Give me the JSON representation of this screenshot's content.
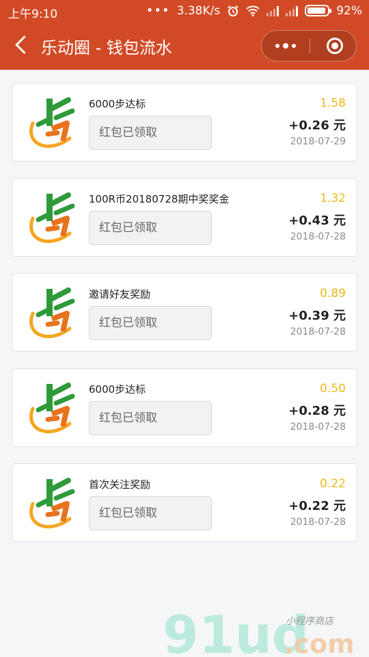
{
  "status_bar": {
    "time": "上午9:10",
    "network_speed": "3.38K/s",
    "battery": "92%"
  },
  "nav": {
    "title": "乐动圈 - 钱包流水"
  },
  "records": [
    {
      "title": "6000步达标",
      "status": "红包已领取",
      "total": "1.58",
      "amount": "+0.26 元",
      "date": "2018-07-29"
    },
    {
      "title": "100R币20180728期中奖奖金",
      "status": "红包已领取",
      "total": "1.32",
      "amount": "+0.43 元",
      "date": "2018-07-28"
    },
    {
      "title": "邀请好友奖励",
      "status": "红包已领取",
      "total": "0.89",
      "amount": "+0.39 元",
      "date": "2018-07-28"
    },
    {
      "title": "6000步达标",
      "status": "红包已领取",
      "total": "0.50",
      "amount": "+0.28 元",
      "date": "2018-07-28"
    },
    {
      "title": "首次关注奖励",
      "status": "红包已领取",
      "total": "0.22",
      "amount": "+0.22 元",
      "date": "2018-07-28"
    }
  ],
  "watermark": {
    "brand": "91ud",
    "domain": ".com",
    "tagline": "小程序商店"
  },
  "colors": {
    "header": "#d14a25",
    "total": "#f0b820",
    "logo_green": "#2e9a3a",
    "logo_orange": "#e8731e"
  }
}
